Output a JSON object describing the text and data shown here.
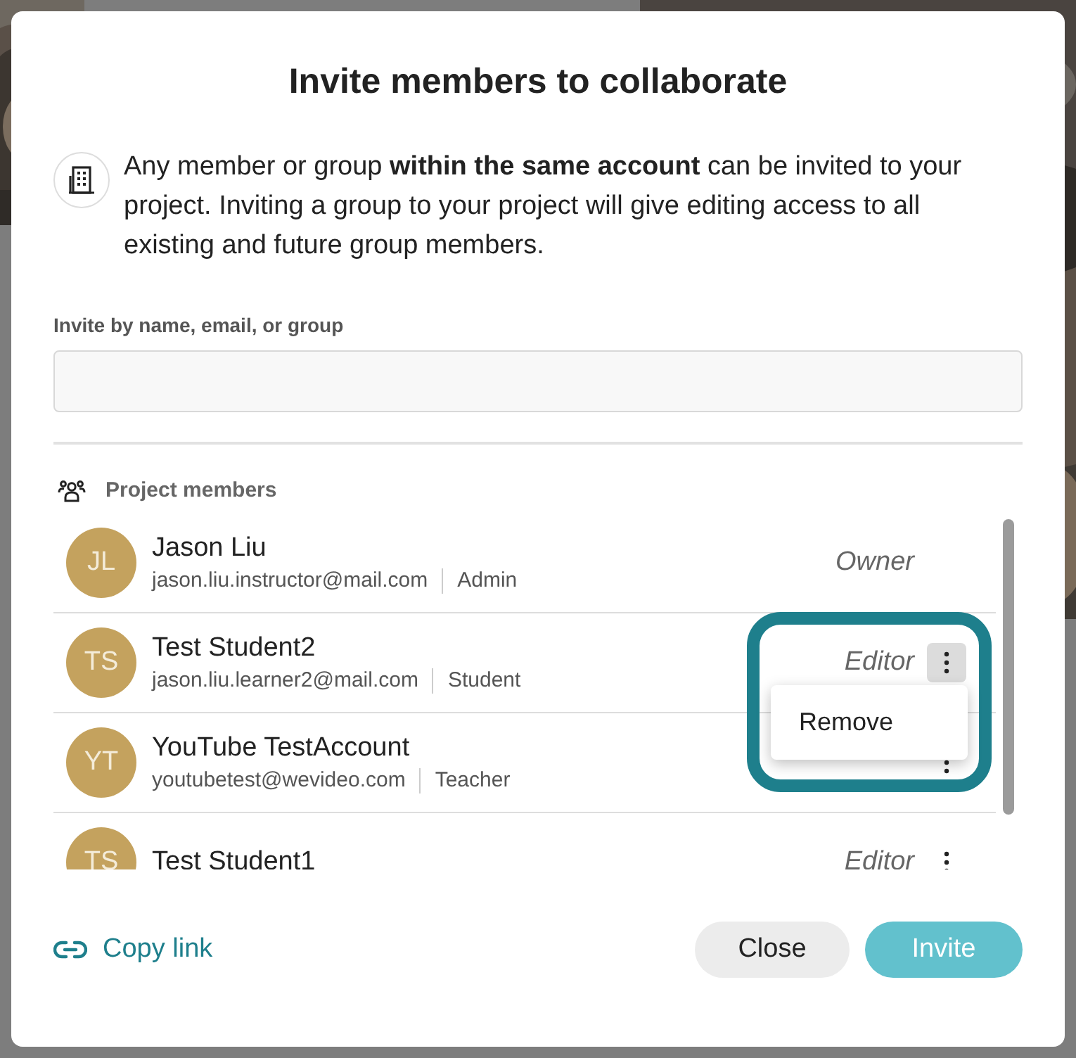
{
  "dialog": {
    "title": "Invite members to collaborate",
    "notice": "Any member or group **within the same account** can be invited to your project. Inviting a group to your project will give editing access to all existing and future group members.",
    "invite_field": {
      "label": "Invite by name, email, or group"
    },
    "members_header": "Project members",
    "members": [
      {
        "initials": "JL",
        "name": "Jason Liu",
        "email": "jason.liu.instructor@mail.com",
        "account_type": "Admin",
        "role": "Owner",
        "has_menu": false,
        "menu_open": false
      },
      {
        "initials": "TS",
        "name": "Test Student2",
        "email": "jason.liu.learner2@mail.com",
        "account_type": "Student",
        "role": "Editor",
        "has_menu": true,
        "menu_open": true
      },
      {
        "initials": "YT",
        "name": "YouTube TestAccount",
        "email": "youtubetest@wevideo.com",
        "account_type": "Teacher",
        "has_menu": true,
        "menu_open": false
      },
      {
        "initials": "TS",
        "name": "Test Student1",
        "role": "Editor",
        "has_menu": true,
        "menu_open": false
      }
    ],
    "menu": {
      "items": [
        "Remove"
      ],
      "highlighted": true
    },
    "copy_link": "Copy link",
    "buttons": [
      {
        "label": "Close",
        "kind": "secondary",
        "disabled": false
      },
      {
        "label": "Invite",
        "kind": "primary",
        "disabled": true
      }
    ]
  }
}
